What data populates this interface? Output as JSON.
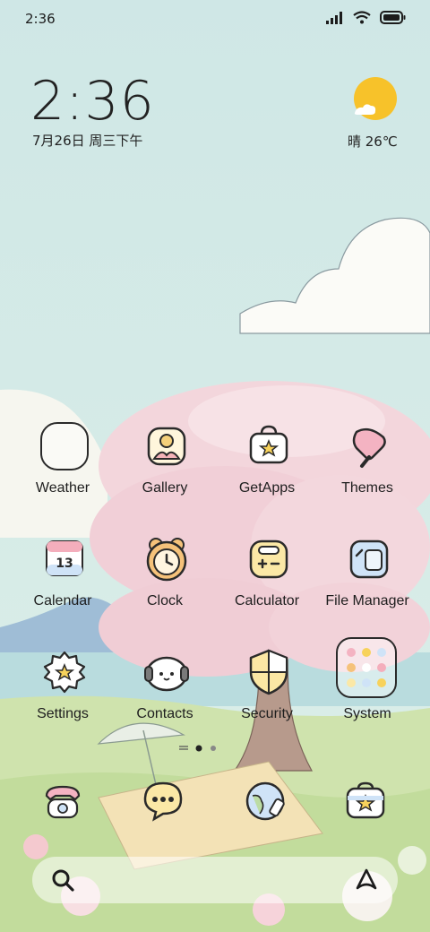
{
  "status_bar": {
    "time": "2:36"
  },
  "widget": {
    "clock": "2:36",
    "date": "7月26日 周三下午",
    "weather": "晴 26℃"
  },
  "apps": [
    {
      "label": "Weather",
      "icon": "weather-icon"
    },
    {
      "label": "Gallery",
      "icon": "gallery-icon"
    },
    {
      "label": "GetApps",
      "icon": "getapps-icon"
    },
    {
      "label": "Themes",
      "icon": "themes-icon"
    },
    {
      "label": "Calendar",
      "icon": "calendar-icon",
      "badge": "13"
    },
    {
      "label": "Clock",
      "icon": "clock-icon"
    },
    {
      "label": "Calculator",
      "icon": "calculator-icon"
    },
    {
      "label": "File Manager",
      "icon": "file-manager-icon"
    },
    {
      "label": "Settings",
      "icon": "settings-icon"
    },
    {
      "label": "Contacts",
      "icon": "contacts-icon"
    },
    {
      "label": "Security",
      "icon": "security-icon"
    },
    {
      "label": "System",
      "icon": "system-folder-icon"
    }
  ],
  "dock": [
    "phone-icon",
    "messages-icon",
    "browser-icon",
    "camera-icon"
  ],
  "page_indicator": {
    "pages": 2,
    "active": 1
  },
  "colors": {
    "sky": "#cfe6e4",
    "tree_pink": "#f2cfd6",
    "grass": "#cfe3b0",
    "sun": "#f7c22a"
  }
}
